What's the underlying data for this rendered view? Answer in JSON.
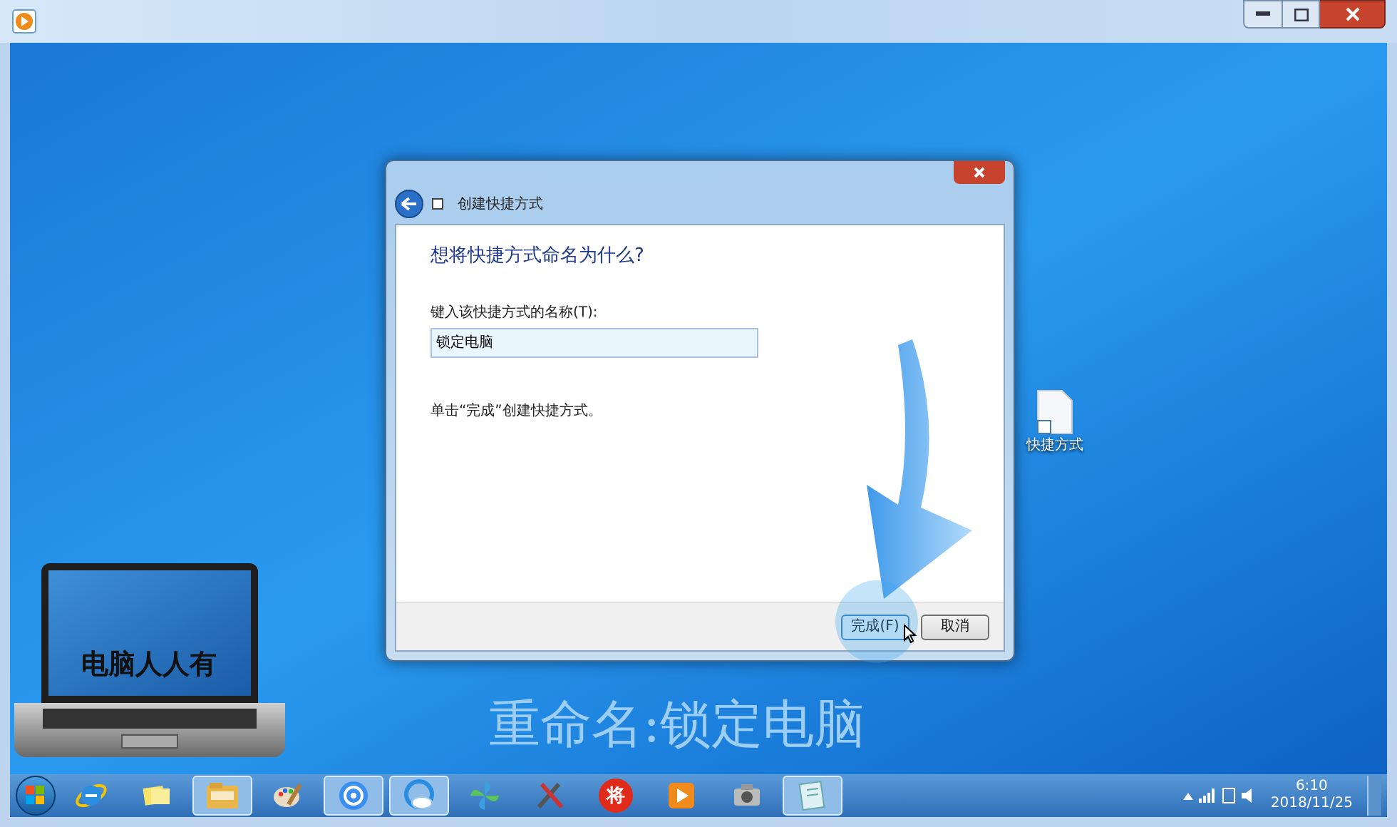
{
  "desktop": {
    "shortcut_label": "快捷方式"
  },
  "dialog": {
    "title": "创建快捷方式",
    "heading": "想将快捷方式命名为什么?",
    "field_label": "键入该快捷方式的名称(T):",
    "field_value": "锁定电脑",
    "hint": "单击“完成”创建快捷方式。",
    "buttons": [
      {
        "label": "完成(F)",
        "selected": true
      },
      {
        "label": "取消",
        "selected": false
      }
    ]
  },
  "overlay": {
    "logo_text": "电脑人人有",
    "caption": "重命名:锁定电脑"
  },
  "taskbar": {
    "items": [
      {
        "kind": "ie",
        "active": false
      },
      {
        "kind": "notes",
        "active": false
      },
      {
        "kind": "folder",
        "active": true
      },
      {
        "kind": "palette",
        "active": false
      },
      {
        "kind": "dots",
        "active": true
      },
      {
        "kind": "cloud",
        "active": true
      },
      {
        "kind": "pinwheel",
        "active": false
      },
      {
        "kind": "tools",
        "active": false
      },
      {
        "kind": "chess",
        "active": false,
        "label": "将"
      },
      {
        "kind": "play",
        "active": false
      },
      {
        "kind": "camera",
        "active": false
      },
      {
        "kind": "note",
        "active": true
      }
    ],
    "clock": {
      "time": "6:10",
      "date": "2018/11/25"
    }
  }
}
